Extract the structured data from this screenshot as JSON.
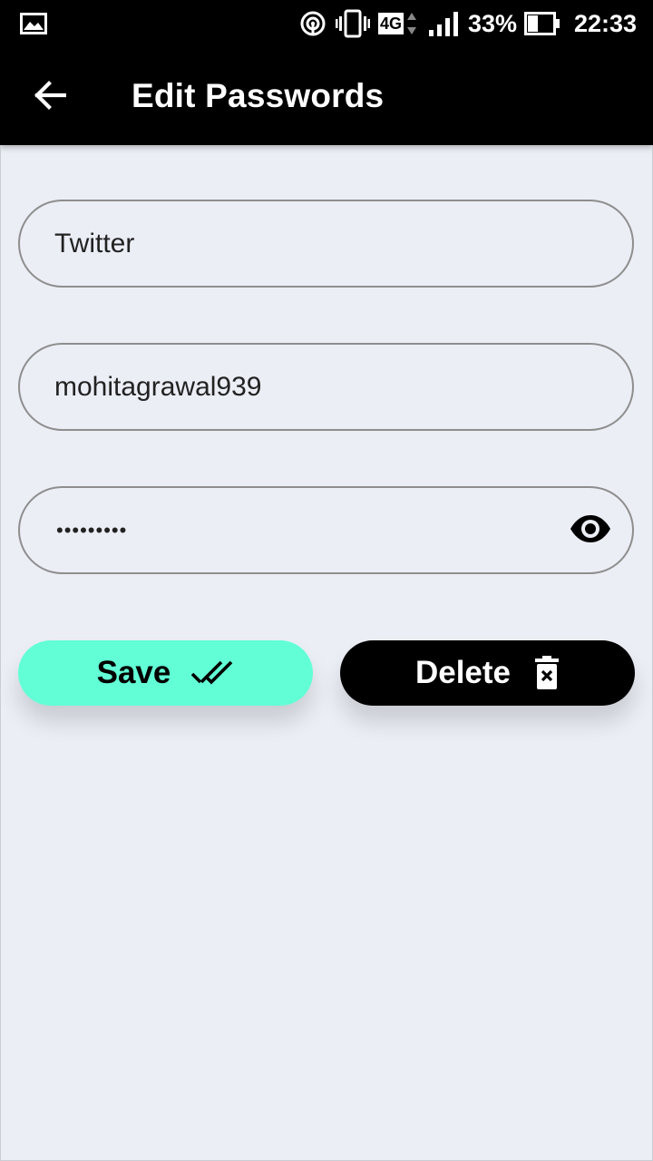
{
  "status_bar": {
    "battery": "33%",
    "time": "22:33",
    "network": "4G"
  },
  "app_bar": {
    "title": "Edit Passwords"
  },
  "form": {
    "site_value": "Twitter",
    "username_value": "mohitagrawal939",
    "password_masked": "•••••••••"
  },
  "buttons": {
    "save_label": "Save",
    "delete_label": "Delete"
  },
  "colors": {
    "accent": "#62FFD6",
    "appbar": "#000000",
    "background": "#EBEEF5",
    "field_border": "#8E8E8E"
  },
  "icons": {
    "back": "arrow-back-icon",
    "eye": "eye-icon",
    "save": "double-check-icon",
    "delete": "delete-forever-icon"
  }
}
